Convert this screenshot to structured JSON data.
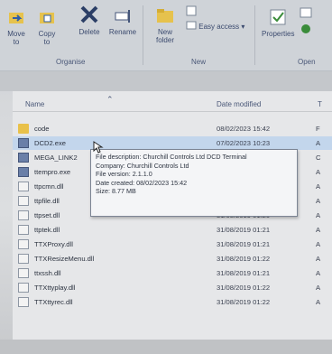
{
  "ribbon": {
    "buttons": [
      {
        "label": "Move to",
        "icon": "move-to-icon"
      },
      {
        "label": "Copy to",
        "icon": "copy-to-icon"
      },
      {
        "label": "Delete",
        "icon": "delete-icon"
      },
      {
        "label": "Rename",
        "icon": "rename-icon"
      },
      {
        "label": "New folder",
        "icon": "new-folder-icon"
      },
      {
        "label": "Properties",
        "icon": "properties-icon"
      }
    ],
    "easy_access": "Easy access",
    "groups": {
      "organise": "Organise",
      "new": "New",
      "open": "Open"
    }
  },
  "columns": {
    "name": "Name",
    "date": "Date modified",
    "type": "T"
  },
  "files": [
    {
      "name": "code",
      "date": "08/02/2023 15:42",
      "type": "F",
      "kind": "folder"
    },
    {
      "name": "DCD2.exe",
      "date": "07/02/2023 10:23",
      "type": "A",
      "kind": "exe"
    },
    {
      "name": "MEGA_LINK2",
      "date": "",
      "type": "C",
      "kind": "exe"
    },
    {
      "name": "ttempro.exe",
      "date": "",
      "type": "A",
      "kind": "exe"
    },
    {
      "name": "ttpcmn.dll",
      "date": "",
      "type": "A",
      "kind": "dll"
    },
    {
      "name": "ttpfile.dll",
      "date": "",
      "type": "A",
      "kind": "dll"
    },
    {
      "name": "ttpset.dll",
      "date": "31/08/2019 01:20",
      "type": "A",
      "kind": "dll"
    },
    {
      "name": "ttptek.dll",
      "date": "31/08/2019 01:21",
      "type": "A",
      "kind": "dll"
    },
    {
      "name": "TTXProxy.dll",
      "date": "31/08/2019 01:21",
      "type": "A",
      "kind": "dll"
    },
    {
      "name": "TTXResizeMenu.dll",
      "date": "31/08/2019 01:22",
      "type": "A",
      "kind": "dll"
    },
    {
      "name": "ttxssh.dll",
      "date": "31/08/2019 01:21",
      "type": "A",
      "kind": "dll"
    },
    {
      "name": "TTXttyplay.dll",
      "date": "31/08/2019 01:22",
      "type": "A",
      "kind": "dll"
    },
    {
      "name": "TTXttyrec.dll",
      "date": "31/08/2019 01:22",
      "type": "A",
      "kind": "dll"
    }
  ],
  "tooltip": {
    "description": "File description: Churchill Controls Ltd DCD Terminal",
    "company": "Company: Churchill Controls Ltd",
    "version": "File version: 2.1.1.0",
    "created": "Date created: 08/02/2023 15:42",
    "size": "Size: 8.77 MB"
  }
}
